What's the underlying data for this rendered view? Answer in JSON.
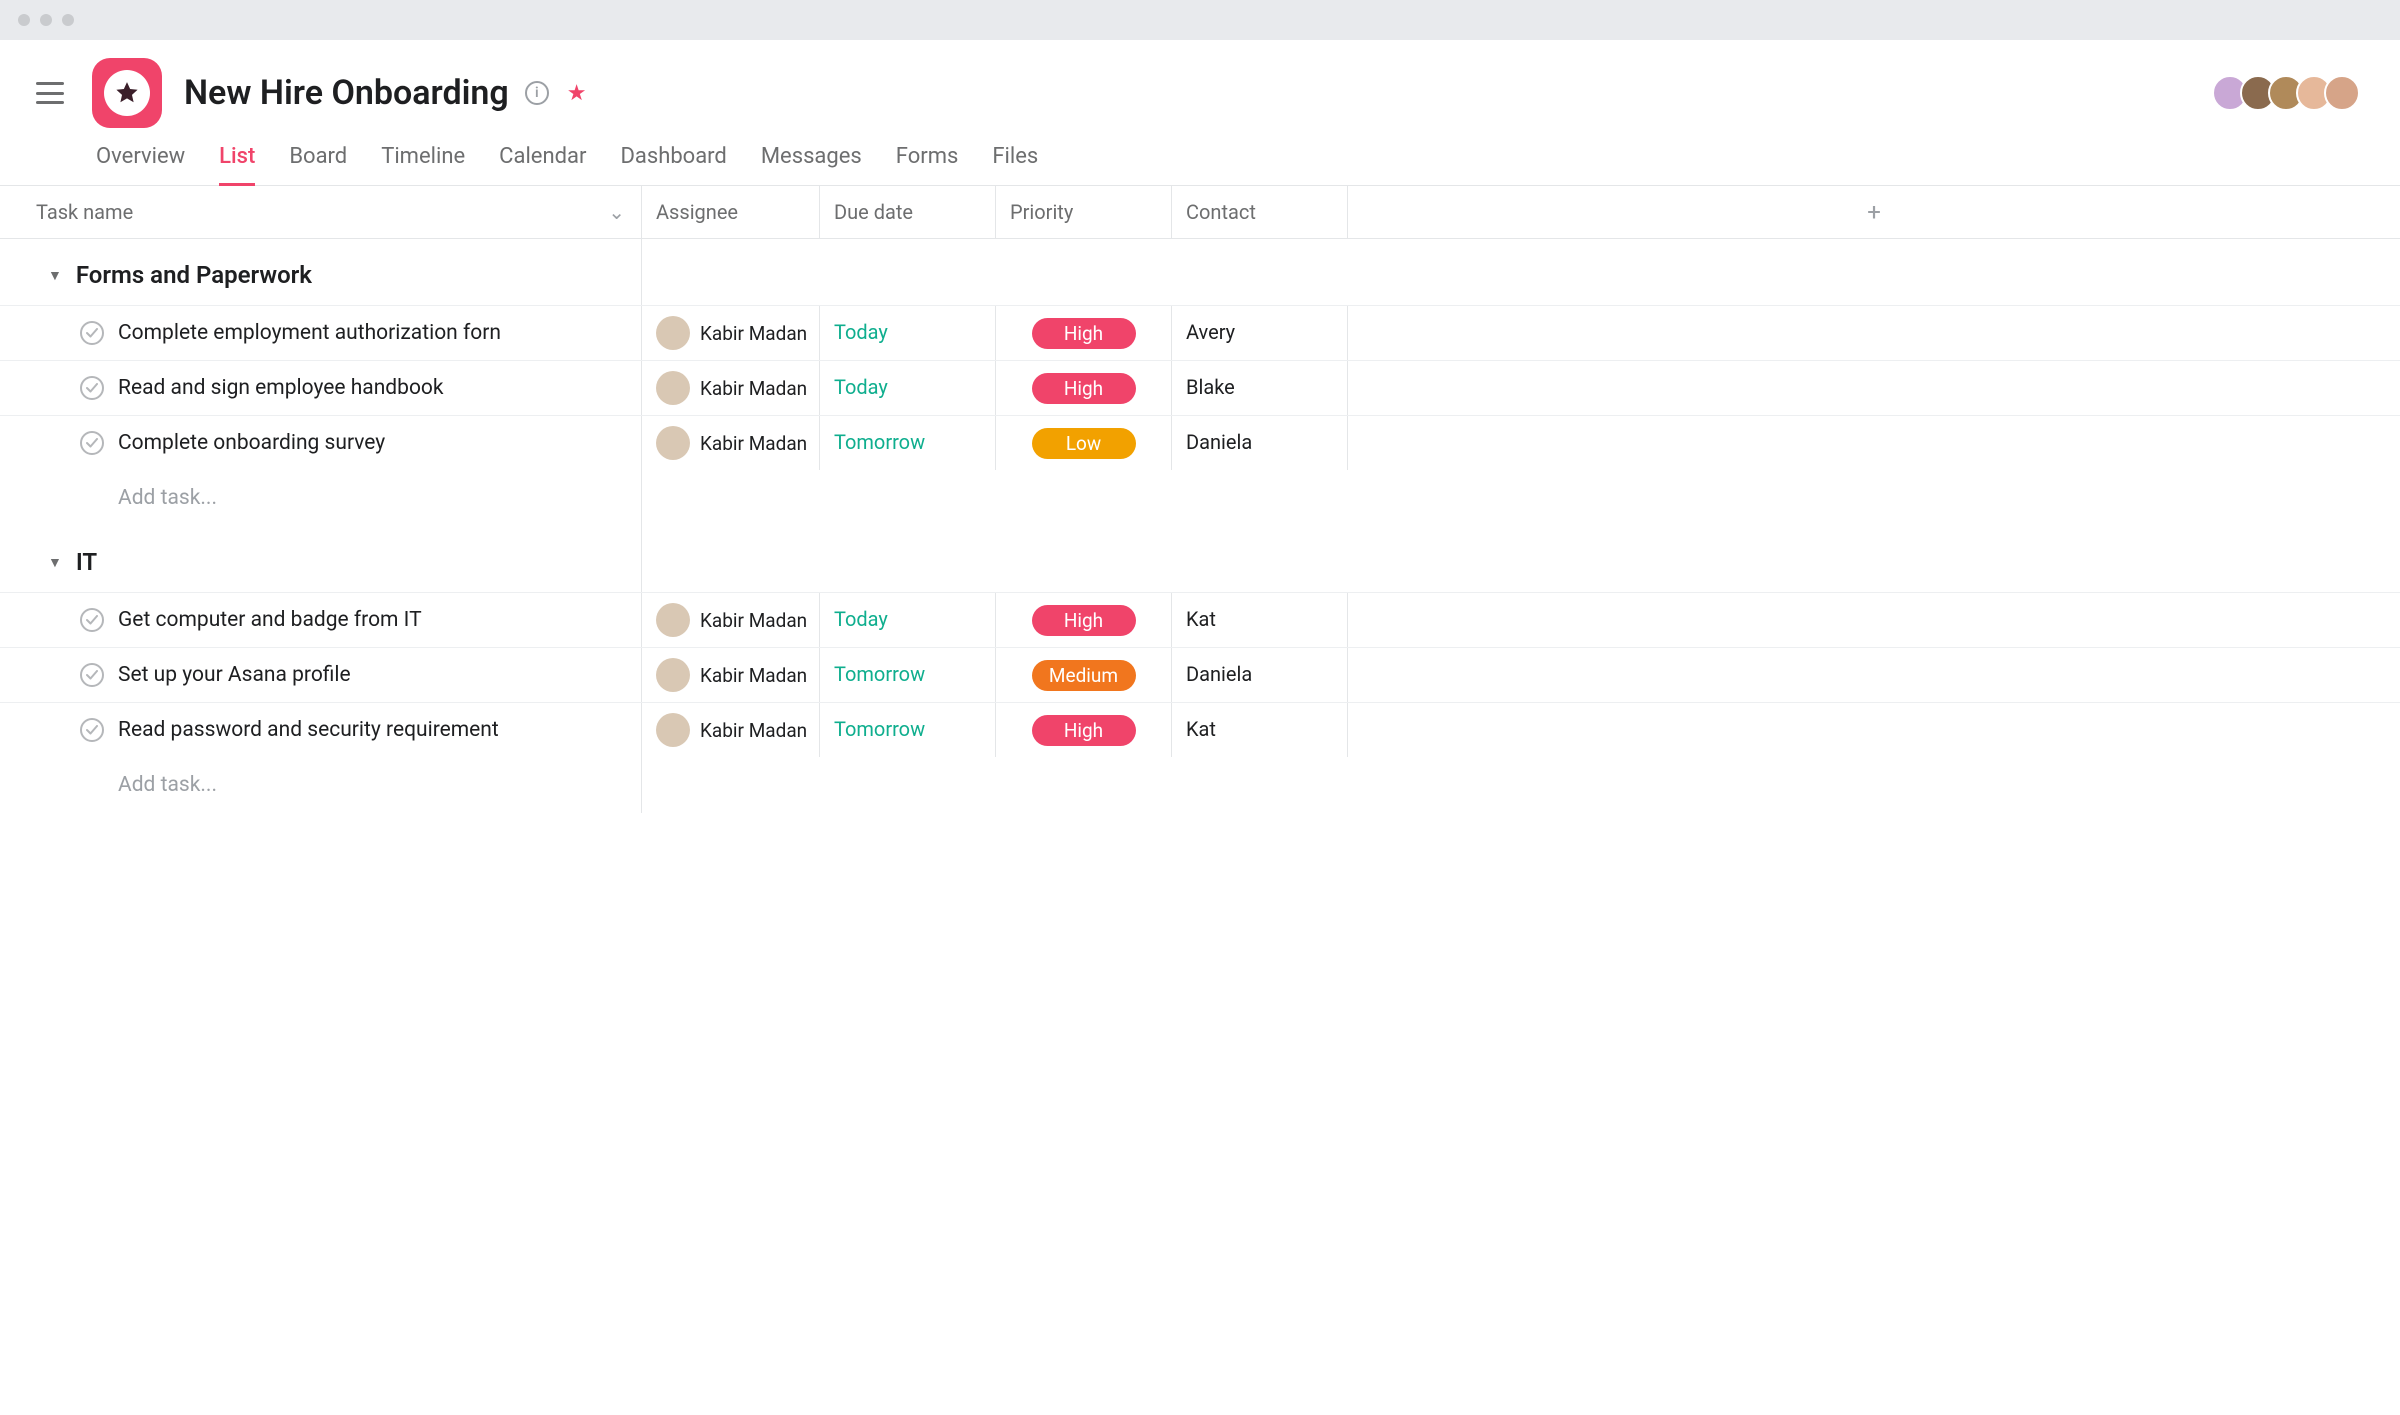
{
  "project": {
    "title": "New Hire Onboarding"
  },
  "tabs": [
    {
      "label": "Overview",
      "active": false
    },
    {
      "label": "List",
      "active": true
    },
    {
      "label": "Board",
      "active": false
    },
    {
      "label": "Timeline",
      "active": false
    },
    {
      "label": "Calendar",
      "active": false
    },
    {
      "label": "Dashboard",
      "active": false
    },
    {
      "label": "Messages",
      "active": false
    },
    {
      "label": "Forms",
      "active": false
    },
    {
      "label": "Files",
      "active": false
    }
  ],
  "columns": {
    "task": "Task name",
    "assignee": "Assignee",
    "due": "Due date",
    "priority": "Priority",
    "contact": "Contact"
  },
  "colors": {
    "high": "#f0446a",
    "medium": "#f1761e",
    "low": "#f2a100",
    "due": "#0fae8e"
  },
  "avatars": [
    {
      "bg": "#c9a8d6"
    },
    {
      "bg": "#8a6a4e"
    },
    {
      "bg": "#b08a5a"
    },
    {
      "bg": "#e6b89a"
    },
    {
      "bg": "#d6a488"
    }
  ],
  "add_task_label": "Add task...",
  "sections": [
    {
      "title": "Forms and Paperwork",
      "tasks": [
        {
          "name": "Complete employment authorization forn",
          "assignee": "Kabir Madan",
          "due": "Today",
          "priority": "High",
          "priority_color": "#f0446a",
          "contact": "Avery"
        },
        {
          "name": "Read and sign employee handbook",
          "assignee": "Kabir Madan",
          "due": "Today",
          "priority": "High",
          "priority_color": "#f0446a",
          "contact": "Blake"
        },
        {
          "name": "Complete onboarding survey",
          "assignee": "Kabir Madan",
          "due": "Tomorrow",
          "priority": "Low",
          "priority_color": "#f2a100",
          "contact": "Daniela"
        }
      ]
    },
    {
      "title": "IT",
      "tasks": [
        {
          "name": "Get computer and badge from IT",
          "assignee": "Kabir Madan",
          "due": "Today",
          "priority": "High",
          "priority_color": "#f0446a",
          "contact": "Kat"
        },
        {
          "name": "Set up your Asana profile",
          "assignee": "Kabir Madan",
          "due": "Tomorrow",
          "priority": "Medium",
          "priority_color": "#f1761e",
          "contact": "Daniela"
        },
        {
          "name": "Read password and security requirement",
          "assignee": "Kabir Madan",
          "due": "Tomorrow",
          "priority": "High",
          "priority_color": "#f0446a",
          "contact": "Kat"
        }
      ]
    }
  ]
}
